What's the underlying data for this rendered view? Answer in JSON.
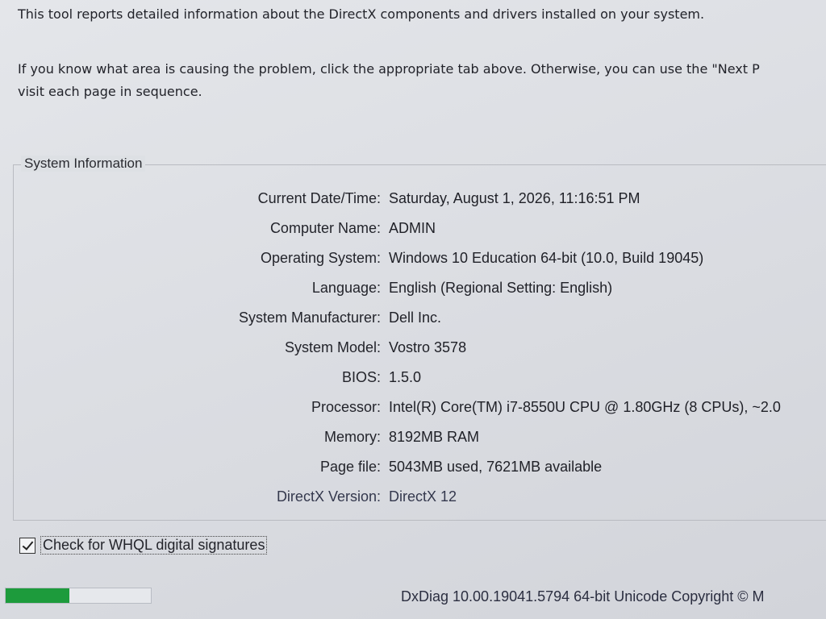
{
  "intro": {
    "line1": "This tool reports detailed information about the DirectX components and drivers installed on your system.",
    "line2": "If you know what area is causing the problem, click the appropriate tab above.  Otherwise, you can use the \"Next P",
    "line3": "visit each page in sequence."
  },
  "system_info": {
    "title": "System Information",
    "rows": [
      {
        "label": "Current Date/Time:",
        "value": "Saturday, August 1, 2026, 11:16:51 PM"
      },
      {
        "label": "Computer Name:",
        "value": "ADMIN"
      },
      {
        "label": "Operating System:",
        "value": "Windows 10 Education 64-bit (10.0, Build 19045)"
      },
      {
        "label": "Language:",
        "value": "English (Regional Setting: English)"
      },
      {
        "label": "System Manufacturer:",
        "value": "Dell Inc."
      },
      {
        "label": "System Model:",
        "value": "Vostro 3578"
      },
      {
        "label": "BIOS:",
        "value": "1.5.0"
      },
      {
        "label": "Processor:",
        "value": "Intel(R) Core(TM) i7-8550U CPU @ 1.80GHz (8 CPUs), ~2.0"
      },
      {
        "label": "Memory:",
        "value": "8192MB RAM"
      },
      {
        "label": "Page file:",
        "value": "5043MB used, 7621MB available"
      },
      {
        "label": "DirectX Version:",
        "value": "DirectX 12"
      }
    ]
  },
  "whql_checkbox": {
    "label": "Check for WHQL digital signatures",
    "checked": true
  },
  "progress": {
    "fraction": 0.44,
    "color": "#1d9b3c"
  },
  "footer": {
    "text": "DxDiag 10.00.19041.5794 64-bit Unicode  Copyright © M"
  }
}
